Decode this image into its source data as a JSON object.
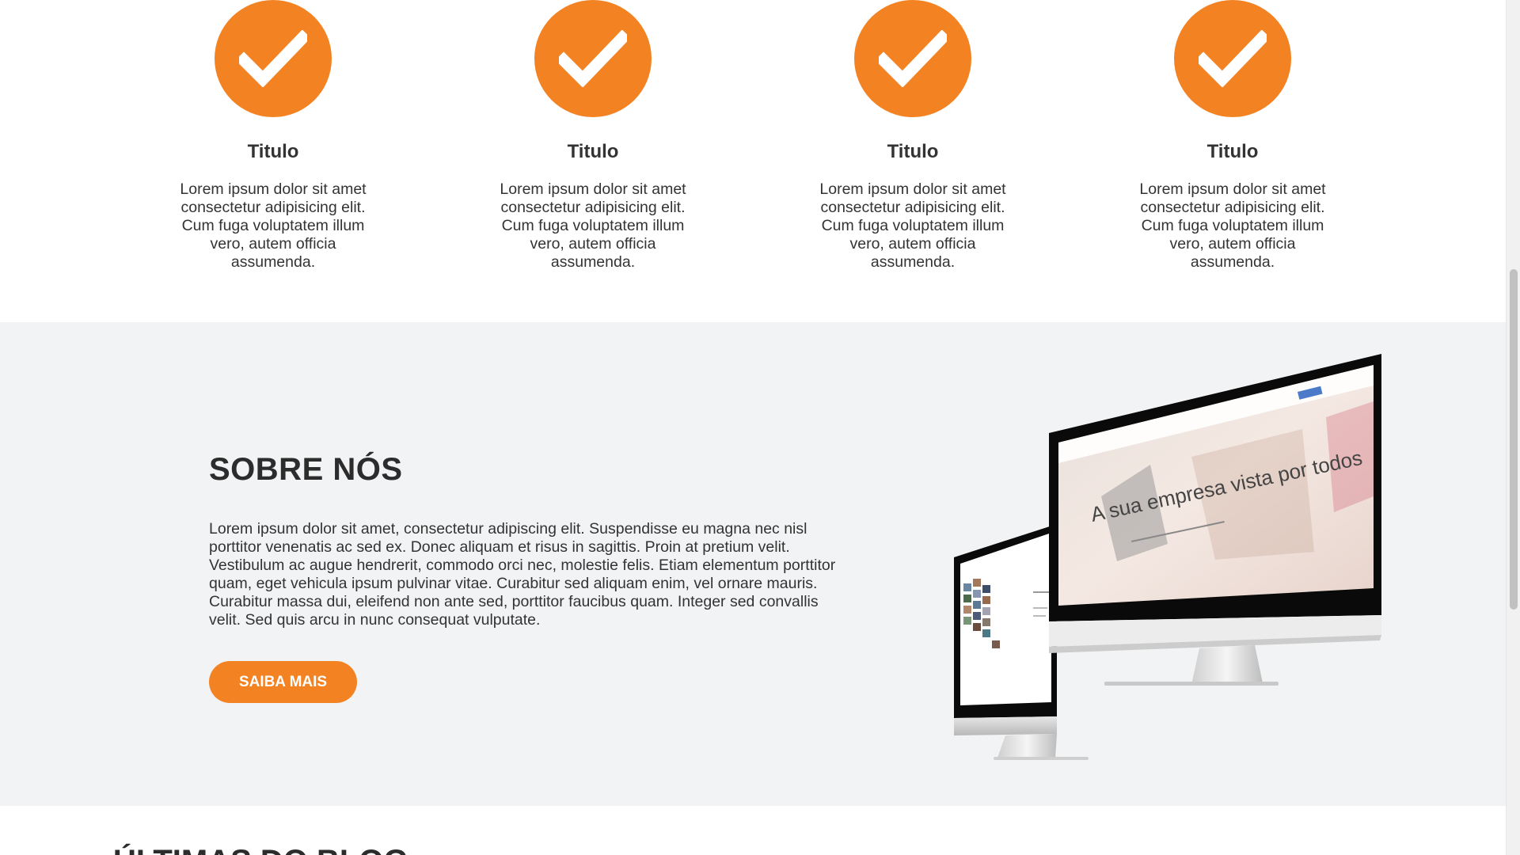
{
  "features": [
    {
      "title": "Titulo",
      "text": "Lorem ipsum dolor sit amet consectetur adipisicing elit. Cum fuga voluptatem illum vero, autem officia assumenda."
    },
    {
      "title": "Titulo",
      "text": "Lorem ipsum dolor sit amet consectetur adipisicing elit. Cum fuga voluptatem illum vero, autem officia assumenda."
    },
    {
      "title": "Titulo",
      "text": "Lorem ipsum dolor sit amet consectetur adipisicing elit. Cum fuga voluptatem illum vero, autem officia assumenda."
    },
    {
      "title": "Titulo",
      "text": "Lorem ipsum dolor sit amet consectetur adipisicing elit. Cum fuga voluptatem illum vero, autem officia assumenda."
    }
  ],
  "about": {
    "title": "SOBRE NÓS",
    "text": "Lorem ipsum dolor sit amet, consectetur adipiscing elit. Suspendisse eu magna nec nisl porttitor venenatis ac sed ex. Donec aliquam et risus in sagittis. Proin at pretium velit. Vestibulum ac augue hendrerit, commodo orci nec, molestie felis. Etiam elementum porttitor quam, eget vehicula ipsum pulvinar vitae. Curabitur sed aliquam enim, vel ornare mauris. Curabitur massa dui, eleifend non ante sed, porttitor faucibus quam. Integer sed convallis velit. Sed quis arcu in nunc consequat vulputate.",
    "button_label": "SAIBA MAIS",
    "mockup_tagline": "A sua empresa vista por todos"
  },
  "blog": {
    "title": "ÚLTIMAS DO BLOG"
  },
  "colors": {
    "accent": "#f38322",
    "section_bg": "#f2f3f4",
    "text": "#333333"
  },
  "icons": {
    "feature_icon": "checkmark-icon"
  }
}
